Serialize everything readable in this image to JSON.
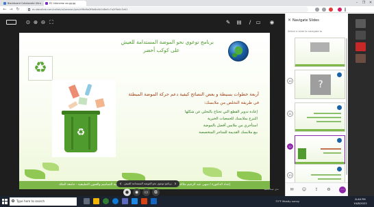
{
  "browser": {
    "tabs": [
      {
        "label": "Blackboard Collaborate Ultra - ",
        "icon_color": "#3a7bd5"
      },
      {
        "label": "R2 Interview: aa.gg.gg",
        "icon_color": "#7b2cbf"
      }
    ],
    "url": "eu.bbcollab.com/collab/ui/session/join/e96d6a3f6e8a4b1d8e5c7a2f9b0c3d41",
    "window_controls": [
      "–",
      "❐",
      "✕"
    ]
  },
  "viewer": {
    "slide": {
      "title_line1": "برنامج توعوي نحو الموضة المستدامة للعيش",
      "title_line2": "على كوكب أخضر",
      "heading": "أربعة خطوات بسيطة و بعض النصائح كيفية دعم حركة الموضة المبطئة",
      "subheading": "في طريقة التخلص من ملابسك:",
      "bullets": [
        "إعادة تدوير القطع التي تحتاج بالتخلي عن شكلها",
        "التبرع بملابسك للجمعيات الخيرية",
        "استأجري من ملابس أفضل بالموضة",
        "بيع ملابسك القديمة للمتاجر المتخصصة"
      ],
      "footer": "إعداد الدكتورة / سهى عبد الرحيم ملاكة - أستاذ مساعد بقسم تصميم الأزياء والنسيج - كلية التصاميم والفنون التطبيقية - جامعة الملك"
    },
    "slide_nav": {
      "label": "برنامج توعوي نحو الموضة المستدامة للعيش",
      "prev": "‹",
      "next": "›"
    },
    "presenter_label": "ندى عبدالحميد"
  },
  "navigator": {
    "title": "Navigate Slides",
    "subtitle": "Select a slide to navigate to",
    "slides": [
      {
        "number": "",
        "selected": false,
        "kind": "image"
      },
      {
        "number": "10",
        "selected": false,
        "kind": "blank"
      },
      {
        "number": "11",
        "selected": false,
        "kind": "text"
      },
      {
        "number": "12",
        "selected": true,
        "kind": "bin"
      },
      {
        "number": "13",
        "selected": false,
        "kind": "text"
      }
    ]
  },
  "taskbar": {
    "search_placeholder": "Type here to search",
    "weather": "73°F Mostly sunny",
    "time": "8:46 PM",
    "date": "10/8/2022"
  },
  "colors": {
    "slide_green": "#4f9b2e",
    "title_green": "#4d9a2b",
    "heading_red": "#a03a10",
    "selection_purple": "#8e24aa",
    "taskbar": "#1c2330"
  }
}
